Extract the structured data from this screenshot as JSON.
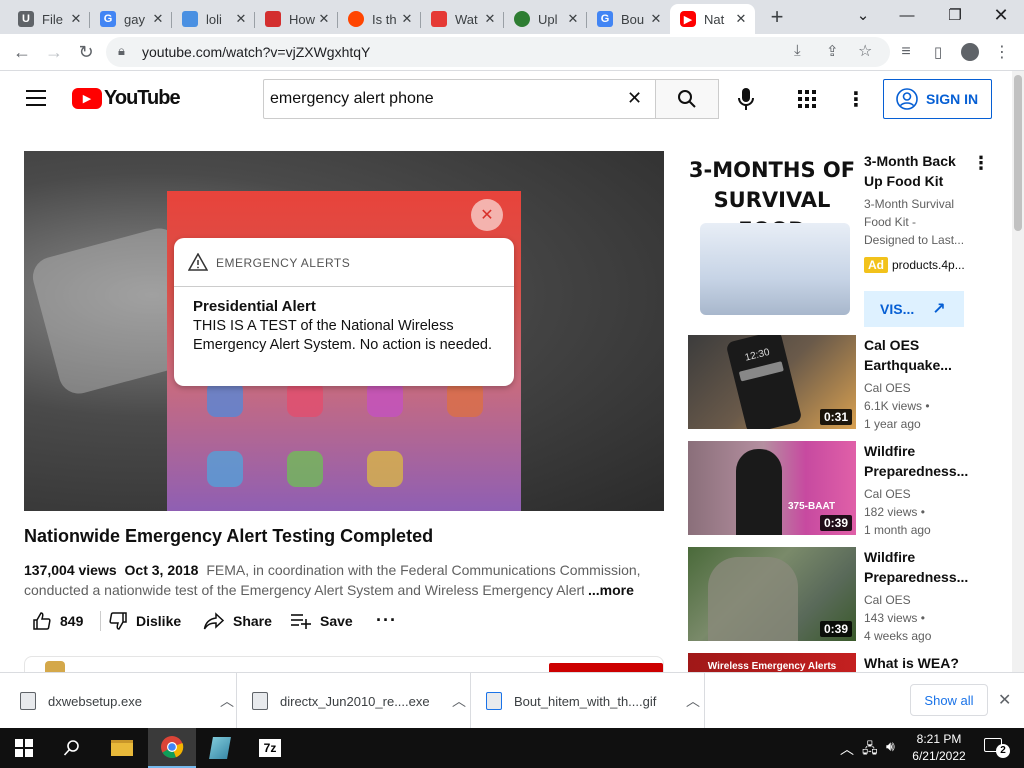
{
  "browser": {
    "tabs": [
      {
        "label": "File",
        "favicon": "U",
        "color": "#5f6368"
      },
      {
        "label": "gay",
        "favicon": "G",
        "color": "#4285f4"
      },
      {
        "label": "loli",
        "favicon": "",
        "color": "#4a90e2"
      },
      {
        "label": "How",
        "favicon": "",
        "color": "#d32f2f"
      },
      {
        "label": "Is th",
        "favicon": "",
        "color": "#ff4500"
      },
      {
        "label": "Wat",
        "favicon": "",
        "color": "#e53935"
      },
      {
        "label": "Upl",
        "favicon": "",
        "color": "#2e7d32"
      },
      {
        "label": "Bou",
        "favicon": "G",
        "color": "#4285f4"
      },
      {
        "label": "Nat",
        "favicon": "",
        "color": "#ff0000"
      }
    ],
    "url": "youtube.com/watch?v=vjZXWgxhtqY"
  },
  "youtube": {
    "logo_text": "YouTube",
    "search_value": "emergency alert phone",
    "signin_label": "SIGN IN"
  },
  "video": {
    "overlay": {
      "header": "EMERGENCY ALERTS",
      "title": "Presidential Alert",
      "body": "THIS IS A TEST of the National Wireless Emergency Alert System. No action is needed."
    },
    "title": "Nationwide Emergency Alert Testing Completed",
    "views": "137,004 views",
    "date": "Oct 3, 2018",
    "description_line1": "FEMA, in coordination with the Federal Communications Commission,",
    "description_line2": "conducted a nationwide test of the Emergency Alert System and Wireless Emergency Alert",
    "more_label": "...more",
    "likes": "849",
    "dislike_label": "Dislike",
    "share_label": "Share",
    "save_label": "Save"
  },
  "sidebar": {
    "ad": {
      "thumb_text_1": "3-MONTHS OF",
      "thumb_text_2": "SURVIVAL FOOD",
      "title": "3-Month Back Up Food Kit",
      "desc": "3-Month Survival Food Kit - Designed to Last...",
      "badge": "Ad",
      "domain": "products.4p...",
      "visit_label": "VIS..."
    },
    "videos": [
      {
        "title": "Cal OES Earthquake...",
        "channel": "Cal OES",
        "views": "6.1K views •",
        "age": "1 year ago",
        "duration": "0:31",
        "thumb_text": "12:30"
      },
      {
        "title": "Wildfire Preparedness...",
        "channel": "Cal OES",
        "views": "182 views •",
        "age": "1 month ago",
        "duration": "0:39",
        "thumb_text": "375-BAAT"
      },
      {
        "title": "Wildfire Preparedness...",
        "channel": "Cal OES",
        "views": "143 views •",
        "age": "4 weeks ago",
        "duration": "0:39",
        "thumb_text": ""
      },
      {
        "title": "What is WEA?",
        "thumb_text": "Wireless Emergency Alerts"
      }
    ]
  },
  "downloads": {
    "items": [
      {
        "name": "dxwebsetup.exe"
      },
      {
        "name": "directx_Jun2010_re....exe"
      },
      {
        "name": "Bout_hitem_with_th....gif"
      }
    ],
    "show_all_label": "Show all"
  },
  "taskbar": {
    "time": "8:21 PM",
    "date": "6/21/2022",
    "notification_count": "2",
    "seven_zip_label": "7z"
  }
}
